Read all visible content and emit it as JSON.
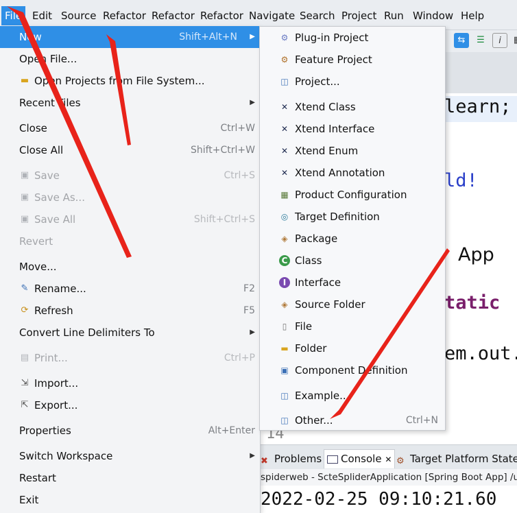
{
  "menubar": {
    "items": [
      "File",
      "Edit",
      "Source",
      "Refactor",
      "Refactor",
      "Refactor",
      "Navigate",
      "Search",
      "Project",
      "Run",
      "Window",
      "Help"
    ]
  },
  "file_menu": {
    "items": [
      {
        "label": "New",
        "shortcut": "Shift+Alt+N",
        "submenu": true,
        "state": "selected"
      },
      {
        "label": "Open File...",
        "state": "normal"
      },
      {
        "label": "Open Projects from File System...",
        "icon": "folder-icon",
        "state": "normal"
      },
      {
        "label": "Recent Files",
        "submenu": true,
        "state": "normal"
      },
      {
        "label": "Close",
        "shortcut": "Ctrl+W",
        "state": "normal"
      },
      {
        "label": "Close All",
        "shortcut": "Shift+Ctrl+W",
        "state": "normal"
      },
      {
        "label": "Save",
        "shortcut": "Ctrl+S",
        "icon": "save-icon",
        "state": "disabled"
      },
      {
        "label": "Save As...",
        "icon": "save-as-icon",
        "state": "disabled"
      },
      {
        "label": "Save All",
        "shortcut": "Shift+Ctrl+S",
        "icon": "save-all-icon",
        "state": "disabled"
      },
      {
        "label": "Revert",
        "state": "disabled"
      },
      {
        "label": "Move...",
        "state": "normal"
      },
      {
        "label": "Rename...",
        "shortcut": "F2",
        "icon": "rename-icon",
        "state": "normal"
      },
      {
        "label": "Refresh",
        "shortcut": "F5",
        "icon": "refresh-icon",
        "state": "normal"
      },
      {
        "label": "Convert Line Delimiters To",
        "submenu": true,
        "state": "normal"
      },
      {
        "label": "Print...",
        "shortcut": "Ctrl+P",
        "icon": "print-icon",
        "state": "disabled"
      },
      {
        "label": "Import...",
        "icon": "import-icon",
        "state": "normal"
      },
      {
        "label": "Export...",
        "icon": "export-icon",
        "state": "normal"
      },
      {
        "label": "Properties",
        "shortcut": "Alt+Enter",
        "state": "normal"
      },
      {
        "label": "Switch Workspace",
        "submenu": true,
        "state": "normal"
      },
      {
        "label": "Restart",
        "state": "normal"
      },
      {
        "label": "Exit",
        "state": "normal"
      }
    ]
  },
  "new_submenu": {
    "items": [
      {
        "label": "Plug-in Project",
        "icon": "plugin-project-icon"
      },
      {
        "label": "Feature Project",
        "icon": "feature-project-icon"
      },
      {
        "label": "Project...",
        "icon": "project-icon"
      },
      {
        "label": "Xtend Class",
        "icon": "xtend-icon"
      },
      {
        "label": "Xtend Interface",
        "icon": "xtend-icon"
      },
      {
        "label": "Xtend Enum",
        "icon": "xtend-icon"
      },
      {
        "label": "Xtend Annotation",
        "icon": "xtend-icon"
      },
      {
        "label": "Product Configuration",
        "icon": "product-configuration-icon"
      },
      {
        "label": "Target Definition",
        "icon": "target-definition-icon"
      },
      {
        "label": "Package",
        "icon": "package-icon"
      },
      {
        "label": "Class",
        "icon": "class-icon"
      },
      {
        "label": "Interface",
        "icon": "interface-icon"
      },
      {
        "label": "Source Folder",
        "icon": "source-folder-icon"
      },
      {
        "label": "File",
        "icon": "file-icon"
      },
      {
        "label": "Folder",
        "icon": "folder-icon"
      },
      {
        "label": "Component Definition",
        "icon": "component-definition-icon"
      },
      {
        "label": "Example...",
        "icon": "example-icon"
      },
      {
        "label": "Other...",
        "shortcut": "Ctrl+N",
        "icon": "other-icon"
      }
    ]
  },
  "editor": {
    "code_fragments": [
      "learn;",
      "ld!",
      "App",
      "tatic",
      "em.",
      "out",
      "."
    ],
    "line_number": "14"
  },
  "bottom_panel": {
    "tabs": [
      "Problems",
      "Console",
      "Target Platform State"
    ],
    "console_path": "spiderweb - ScteSpliderApplication [Spring Boot App] /usr/lib",
    "console_output": "2022-02-25 09:10:21.60"
  },
  "colors": {
    "selection": "#2f8fe6",
    "menu_bg": "#f3f4f6",
    "disabled_text": "#a3a5a9",
    "annotation": "#e8231a"
  }
}
